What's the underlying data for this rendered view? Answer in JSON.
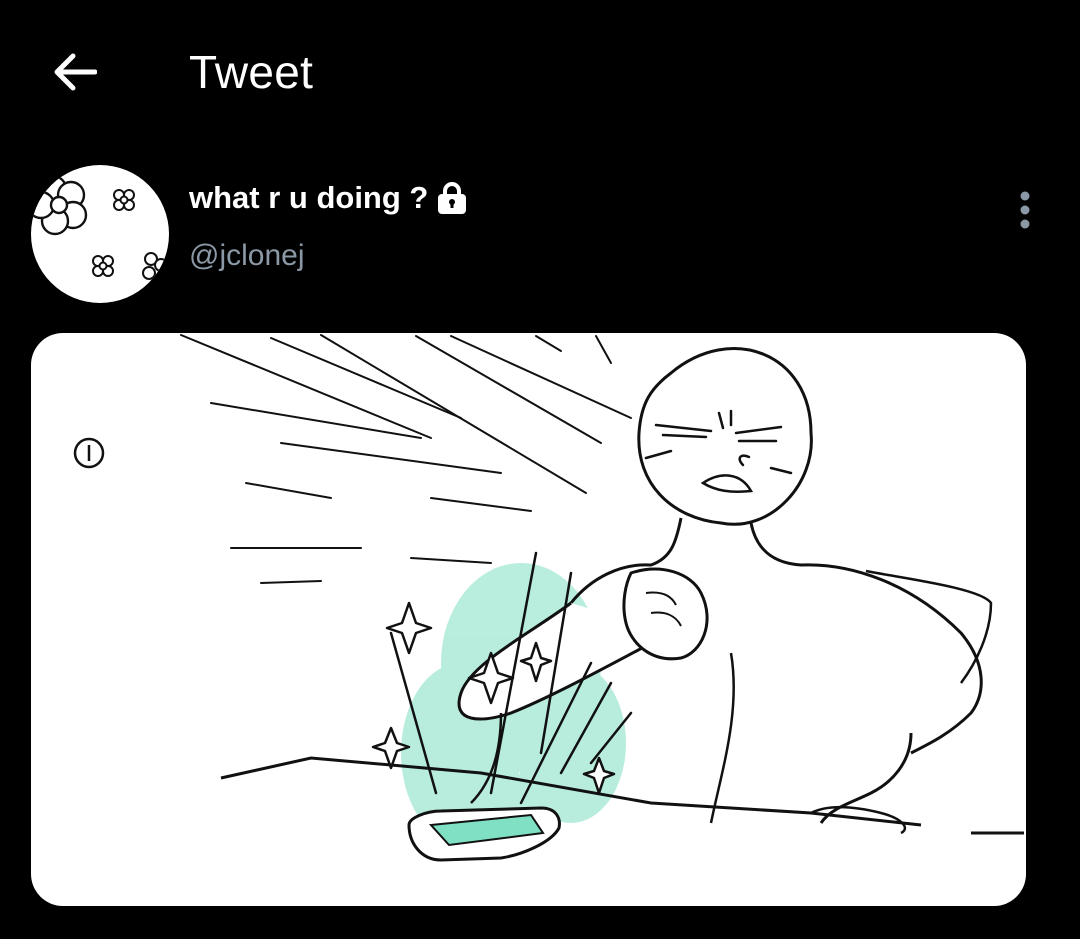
{
  "header": {
    "title": "Tweet",
    "back_icon": "arrow-left-icon"
  },
  "author": {
    "display_name": "what r u doing ?",
    "handle": "@jclonej",
    "protected_icon": "lock-icon",
    "avatar_icon": "flower-doodle-avatar"
  },
  "more_menu_icon": "more-vertical-icon",
  "media": {
    "type": "comic-illustration",
    "panel_number": "1",
    "accent_color": "#7fe0c4"
  },
  "colors": {
    "background": "#000000",
    "text_primary": "#ffffff",
    "text_secondary": "#8b98a5",
    "accent_green": "#7fe0c4"
  }
}
